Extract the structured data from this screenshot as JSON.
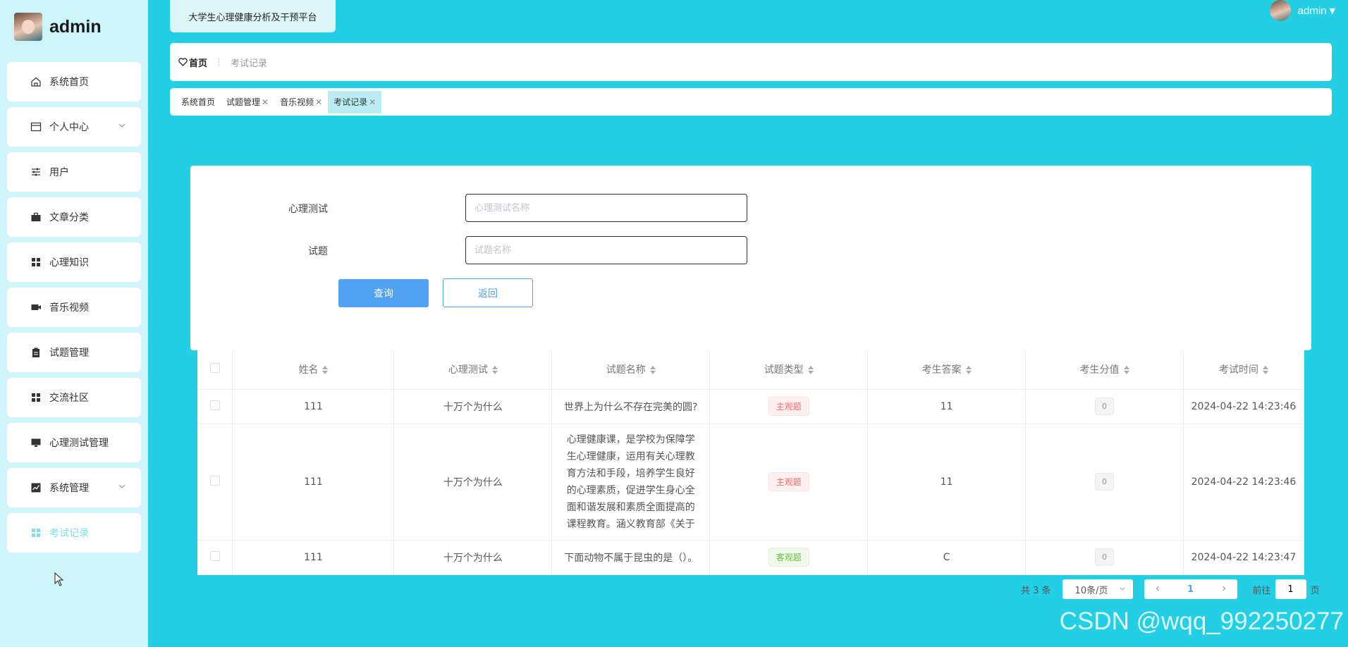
{
  "brand": {
    "title": "admin"
  },
  "app_title": "大学生心理健康分析及干预平台",
  "user_menu": {
    "name": "admin",
    "caret": "▼"
  },
  "sidebar": {
    "items": [
      {
        "label": "系统首页",
        "icon": "home-icon"
      },
      {
        "label": "个人中心",
        "icon": "card-icon",
        "expandable": true
      },
      {
        "label": "用户",
        "icon": "sliders-icon"
      },
      {
        "label": "文章分类",
        "icon": "briefcase-icon"
      },
      {
        "label": "心理知识",
        "icon": "grid-icon"
      },
      {
        "label": "音乐视频",
        "icon": "video-icon"
      },
      {
        "label": "试题管理",
        "icon": "clipboard-icon"
      },
      {
        "label": "交流社区",
        "icon": "grid-icon"
      },
      {
        "label": "心理测试管理",
        "icon": "monitor-icon"
      },
      {
        "label": "系统管理",
        "icon": "chart-icon",
        "expandable": true
      },
      {
        "label": "考试记录",
        "icon": "grid-icon",
        "active": true
      }
    ]
  },
  "breadcrumb": {
    "home": "首页",
    "separator": "⋮",
    "current": "考试记录"
  },
  "tabs": [
    {
      "label": "系统首页",
      "closable": false
    },
    {
      "label": "试题管理",
      "closable": true
    },
    {
      "label": "音乐视频",
      "closable": true
    },
    {
      "label": "考试记录",
      "closable": true,
      "active": true
    }
  ],
  "search": {
    "test_label": "心理测试",
    "test_placeholder": "心理测试名称",
    "question_label": "试题",
    "question_placeholder": "试题名称",
    "query_button": "查询",
    "back_button": "返回"
  },
  "table": {
    "headers": [
      "姓名",
      "心理测试",
      "试题名称",
      "试题类型",
      "考生答案",
      "考生分值",
      "考试时间"
    ],
    "rows": [
      {
        "name": "111",
        "test": "十万个为什么",
        "question": "世界上为什么不存在完美的圆?",
        "type": "主观题",
        "type_kind": "subjective",
        "answer": "11",
        "score": "0",
        "time": "2024-04-22 14:23:46"
      },
      {
        "name": "111",
        "test": "十万个为什么",
        "question": "心理健康课，是学校为保障学生心理健康，运用有关心理教育方法和手段，培养学生良好的心理素质，促进学生身心全面和谐发展和素质全面提高的课程教育。涵义教育部《关于",
        "type": "主观题",
        "type_kind": "subjective",
        "answer": "11",
        "score": "0",
        "time": "2024-04-22 14:23:46"
      },
      {
        "name": "111",
        "test": "十万个为什么",
        "question": "下面动物不属于昆虫的是（）。",
        "type": "客观题",
        "type_kind": "objective",
        "answer": "C",
        "score": "0",
        "time": "2024-04-22 14:23:47"
      }
    ]
  },
  "pagination": {
    "total": "共 3 条",
    "page_size": "10条/页",
    "current_page": "1",
    "goto_prefix": "前往",
    "goto_value": "1",
    "goto_suffix": "页"
  },
  "watermark": "CSDN @wqq_992250277",
  "colors": {
    "background": "#22cfe5",
    "sidebar": "#cdf4f8",
    "primary": "#4fa1f3",
    "subjective_tag": "#f56c6c",
    "objective_tag": "#67c23a"
  }
}
